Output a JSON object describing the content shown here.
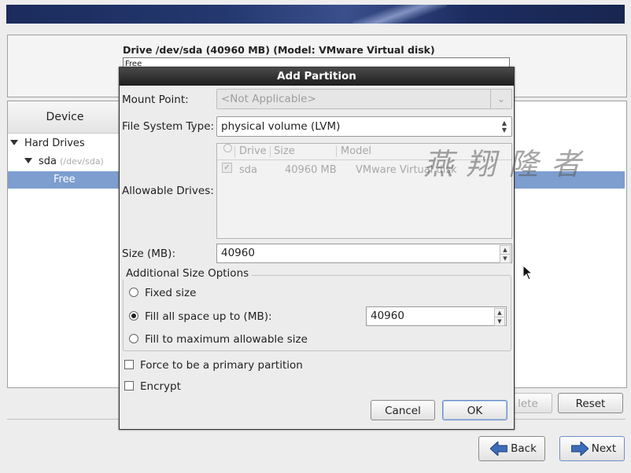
{
  "drive_panel": {
    "title": "Drive /dev/sda (40960 MB) (Model: VMware Virtual disk)",
    "bar_label": "Free"
  },
  "device_list": {
    "header": "Device",
    "tree": {
      "group": "Hard Drives",
      "drive_name": "sda",
      "drive_path": "(/dev/sda)",
      "free": "Free"
    }
  },
  "bottom_buttons": {
    "delete_partial": "lete",
    "reset": "Reset",
    "back": "Back",
    "next": "Next"
  },
  "dialog": {
    "title": "Add Partition",
    "mount_point_label": "Mount Point:",
    "mount_point_value": "<Not Applicable>",
    "fs_type_label": "File System Type:",
    "fs_type_value": "physical volume (LVM)",
    "allowable_drives_label": "Allowable Drives:",
    "drives_columns": [
      "Drive",
      "Size",
      "Model"
    ],
    "drives_rows": [
      {
        "drive": "sda",
        "size": "40960 MB",
        "model": "VMware Virtual disk"
      }
    ],
    "size_label": "Size (MB):",
    "size_value": "40960",
    "additional_title": "Additional Size Options",
    "option_fixed": "Fixed size",
    "option_fill_upto": "Fill all space up to (MB):",
    "fill_upto_value": "40960",
    "option_fill_max": "Fill to maximum allowable size",
    "selected_option": "fill_upto",
    "force_primary": "Force to be a primary partition",
    "encrypt": "Encrypt",
    "cancel": "Cancel",
    "ok": "OK"
  },
  "watermark": "燕 翔 隆 者",
  "colors": {
    "selection": "#7d9ecf",
    "dialog_title_bg": "#2b2b2b",
    "banner": "#24386f"
  }
}
